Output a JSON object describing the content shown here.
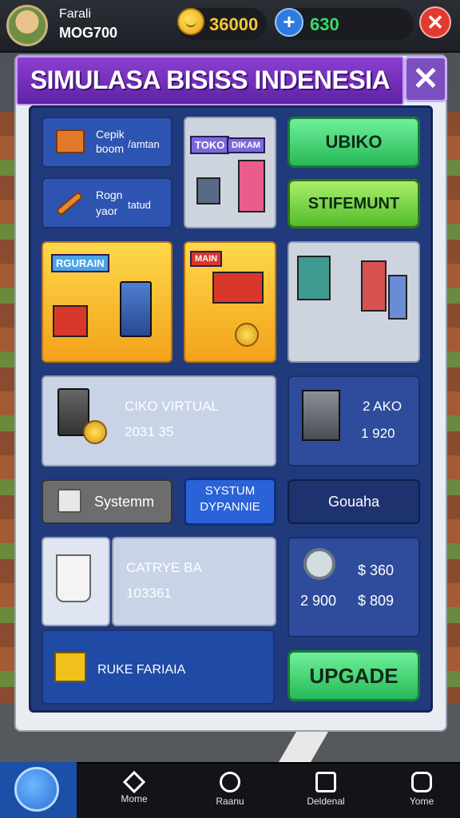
{
  "hud": {
    "player_name": "Farali",
    "player_id": "MOG700",
    "coins": "36000",
    "gems": "630",
    "add_icon": "+",
    "close_icon": "✕"
  },
  "panel": {
    "title": "SIMULASA BISISS INDENESIA",
    "close_icon": "✕"
  },
  "cards": {
    "card1_line1": "Cepik",
    "card1_line2": "boom",
    "card1_line3": "/amtan",
    "card2_line1": "Rogn",
    "card2_line2": "yaor",
    "card2_line3": "tatud",
    "toko_sign": "TOKO",
    "toko_sign2": "DIKAM",
    "btn_ubiko": "UBIKO",
    "btn_stifemunt": "STIFEMUNT",
    "yellow1_sign": "RGURAIN",
    "yellow2_sign": "MAIN",
    "ciko_title": "CIKO VIRTUAL",
    "ciko_value": "2031 35",
    "ako_title": "2 AKO",
    "ako_value": "1 920",
    "system_label": "Systemm",
    "system_dynamic_line1": "SYSTUM",
    "system_dynamic_line2": "DYPANNIE",
    "gouaha": "Gouaha",
    "catrye_title": "CATRYE BA",
    "catrye_value": "103361",
    "price1": "$ 360",
    "stat_left": "2 900",
    "price2": "$ 809",
    "rukefariaia": "RUKE FARIAIA",
    "btn_upgrade": "UPGADE"
  },
  "nav": {
    "items": [
      {
        "label": "Mome",
        "icon": "home-icon"
      },
      {
        "label": "Raanu",
        "icon": "circle-icon"
      },
      {
        "label": "Deldenal",
        "icon": "square-icon"
      },
      {
        "label": "Yome",
        "icon": "hexagon-icon"
      }
    ]
  },
  "colors": {
    "title_bar": "#6a2cb8",
    "inner_panel": "#213a7c",
    "accent_green": "#2fc95e",
    "coin": "#f5c53a",
    "gem": "#39d96a",
    "danger": "#e23a2f"
  }
}
